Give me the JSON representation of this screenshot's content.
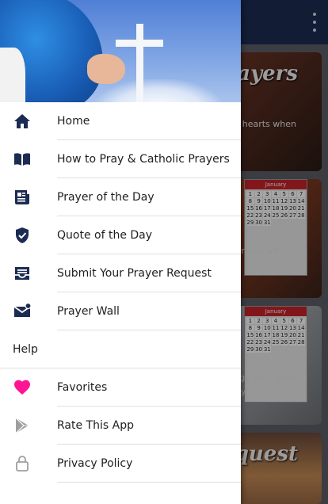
{
  "background": {
    "cards": [
      {
        "title": "Prayers",
        "text": "our hearts when"
      },
      {
        "title": "",
        "text": "your day with"
      },
      {
        "title": "",
        "text": "urage you. Start daily"
      },
      {
        "title": "quest",
        "text": ""
      }
    ],
    "calendar": {
      "month": "January",
      "days": [
        "1",
        "2",
        "3",
        "4",
        "5",
        "6",
        "7",
        "8",
        "9",
        "10",
        "11",
        "12",
        "13",
        "14",
        "15",
        "16",
        "17",
        "18",
        "19",
        "20",
        "21",
        "22",
        "23",
        "24",
        "25",
        "26",
        "27",
        "28",
        "29",
        "30",
        "31"
      ]
    }
  },
  "drawer": {
    "items": [
      {
        "label": "Home",
        "icon": "home-icon"
      },
      {
        "label": "How to Pray & Catholic Prayers",
        "icon": "book-icon"
      },
      {
        "label": "Prayer of the Day",
        "icon": "newspaper-icon"
      },
      {
        "label": "Quote of the Day",
        "icon": "verified-shield-icon"
      },
      {
        "label": "Submit Your Prayer Request",
        "icon": "inbox-tray-icon"
      },
      {
        "label": "Prayer Wall",
        "icon": "mail-badge-icon"
      }
    ],
    "section_label": "Help",
    "help_items": [
      {
        "label": "Favorites",
        "icon": "heart-icon"
      },
      {
        "label": "Rate This App",
        "icon": "play-store-icon"
      },
      {
        "label": "Privacy Policy",
        "icon": "lock-icon"
      }
    ]
  },
  "colors": {
    "icon_navy": "#1c2b52",
    "heart_pink": "#ff1493",
    "icon_gray": "#9e9e9e",
    "appbar": "#1c2b52"
  }
}
